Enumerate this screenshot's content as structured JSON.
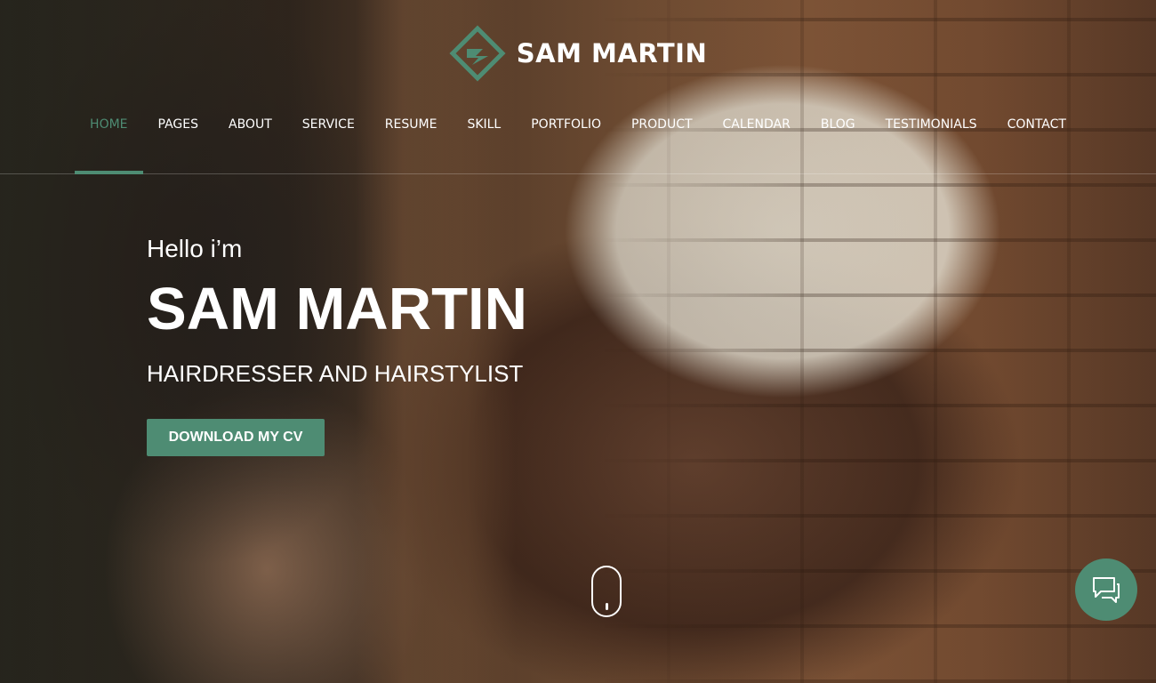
{
  "brand": {
    "name": "SAM MARTIN",
    "logo_icon": "diamond-logo-icon",
    "accent_color": "#4e8c73"
  },
  "nav": {
    "items": [
      {
        "label": "HOME",
        "active": true
      },
      {
        "label": "PAGES"
      },
      {
        "label": "ABOUT"
      },
      {
        "label": "SERVICE"
      },
      {
        "label": "RESUME"
      },
      {
        "label": "SKILL"
      },
      {
        "label": "PORTFOLIO"
      },
      {
        "label": "PRODUCT"
      },
      {
        "label": "CALENDAR"
      },
      {
        "label": "BLOG"
      },
      {
        "label": "TESTIMONIALS"
      },
      {
        "label": "CONTACT"
      }
    ]
  },
  "hero": {
    "greeting": "Hello i’m",
    "name": "SAM MARTIN",
    "role": "HAIRDRESSER AND HAIRSTYLIST",
    "cv_button": "DOWNLOAD MY CV"
  },
  "widgets": {
    "scroll_icon": "scroll-mouse-icon",
    "chat_icon": "chat-bubbles-icon"
  }
}
